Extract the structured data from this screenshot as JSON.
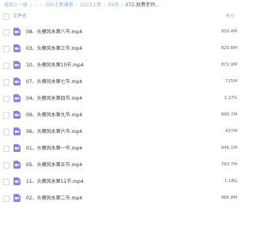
{
  "breadcrumb": {
    "items": [
      "返回上一级",
      "...",
      "000上新课程",
      "2023上新",
      "04月",
      "072.就费老师..."
    ]
  },
  "table": {
    "columns": {
      "name": "文件名",
      "size": "大小"
    },
    "rows": [
      {
        "name": "08、头傻风水第八节.mp4",
        "size": "950.4M"
      },
      {
        "name": "03、头傻风水第三节.mp4",
        "size": "829.8M"
      },
      {
        "name": "10、头傻风水第10节.mp4",
        "size": "872.9M"
      },
      {
        "name": "07、头傻风水第七节.mp4",
        "size": "715M"
      },
      {
        "name": "04、头傻风水第四节.mp4",
        "size": "1.27G"
      },
      {
        "name": "09、头傻风水第九节.mp4",
        "size": "886.7M"
      },
      {
        "name": "06、头傻风水第六节.mp4",
        "size": "437M"
      },
      {
        "name": "01、头傻风水第一节.mp4",
        "size": "946.1M"
      },
      {
        "name": "05、头傻风水第五节.mp4",
        "size": "783.7M"
      },
      {
        "name": "11、头傻风水第11节.mp4",
        "size": "1.18G"
      },
      {
        "name": "02、头傻风水第二节.mp4",
        "size": "986.8M"
      }
    ]
  },
  "icons": {
    "file": "video-file-icon"
  },
  "colors": {
    "accent": "#7fb0f0",
    "file_icon": "#8a82e6"
  }
}
